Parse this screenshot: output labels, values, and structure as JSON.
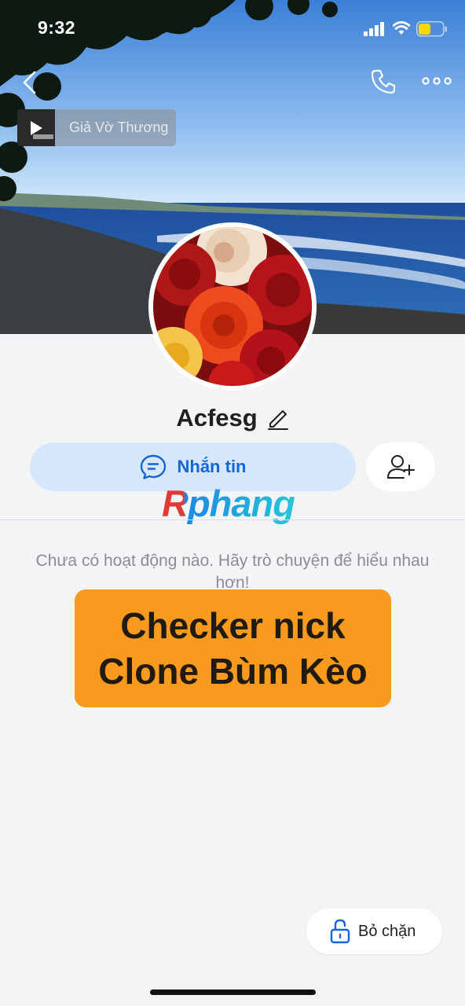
{
  "status_bar": {
    "time": "9:32"
  },
  "header": {
    "music": {
      "title": "Giả Vờ Thương"
    }
  },
  "profile": {
    "name": "Acfesg"
  },
  "actions": {
    "message_label": "Nhắn tin"
  },
  "watermark": "Rphang",
  "feed": {
    "empty_message": "Chưa có hoạt động nào. Hãy trò chuyện để hiểu nhau hơn!"
  },
  "banner": {
    "line1": "Checker nick",
    "line2": "Clone Bùm Kèo"
  },
  "footer": {
    "unblock_label": "Bỏ chặn"
  },
  "icons": {
    "back": "chevron-left-icon",
    "call": "phone-icon",
    "more": "more-horizontal-icon",
    "play": "play-icon",
    "edit": "pencil-icon",
    "message": "chat-bubble-icon",
    "add_friend": "user-plus-icon",
    "unlock": "unlock-icon"
  },
  "colors": {
    "accent": "#1565d8",
    "message_button_bg": "#d7e7fb",
    "banner_bg": "#f79a1d",
    "page_bg": "#f3f4f6"
  }
}
